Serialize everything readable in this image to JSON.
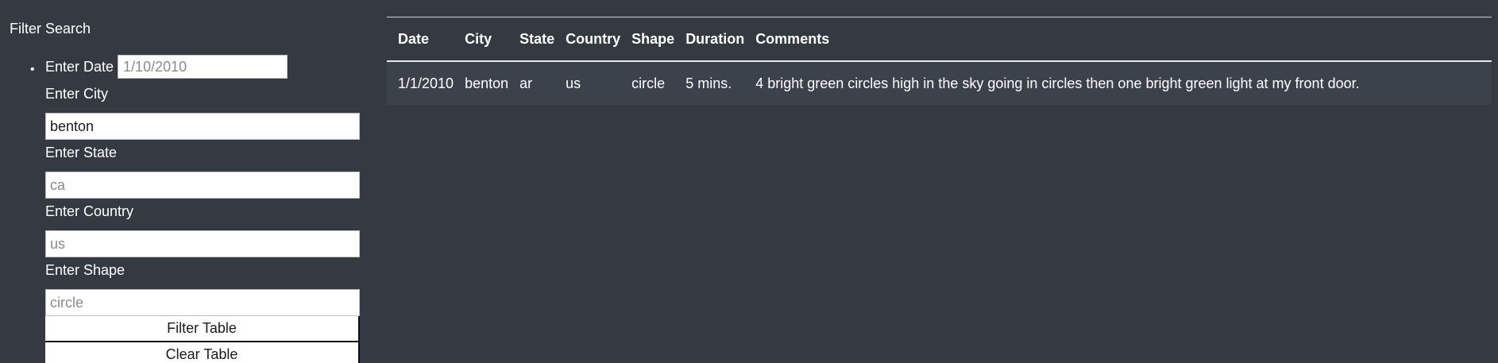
{
  "sidebar": {
    "title": "Filter Search",
    "date": {
      "label": "Enter Date",
      "placeholder": "1/10/2010",
      "value": ""
    },
    "city": {
      "label": "Enter City",
      "placeholder": "",
      "value": "benton"
    },
    "state": {
      "label": "Enter State",
      "placeholder": "ca",
      "value": ""
    },
    "country": {
      "label": "Enter Country",
      "placeholder": "us",
      "value": ""
    },
    "shape": {
      "label": "Enter Shape",
      "placeholder": "circle",
      "value": ""
    },
    "filter_button": "Filter Table",
    "clear_button": "Clear Table"
  },
  "table": {
    "headers": [
      "Date",
      "City",
      "State",
      "Country",
      "Shape",
      "Duration",
      "Comments"
    ],
    "rows": [
      [
        "1/1/2010",
        "benton",
        "ar",
        "us",
        "circle",
        "5 mins.",
        "4 bright green circles high in the sky going in circles then one bright green light at my front door."
      ]
    ]
  },
  "colors": {
    "background": "#353a42",
    "row_background": "#3c424b",
    "text": "#ffffff"
  }
}
